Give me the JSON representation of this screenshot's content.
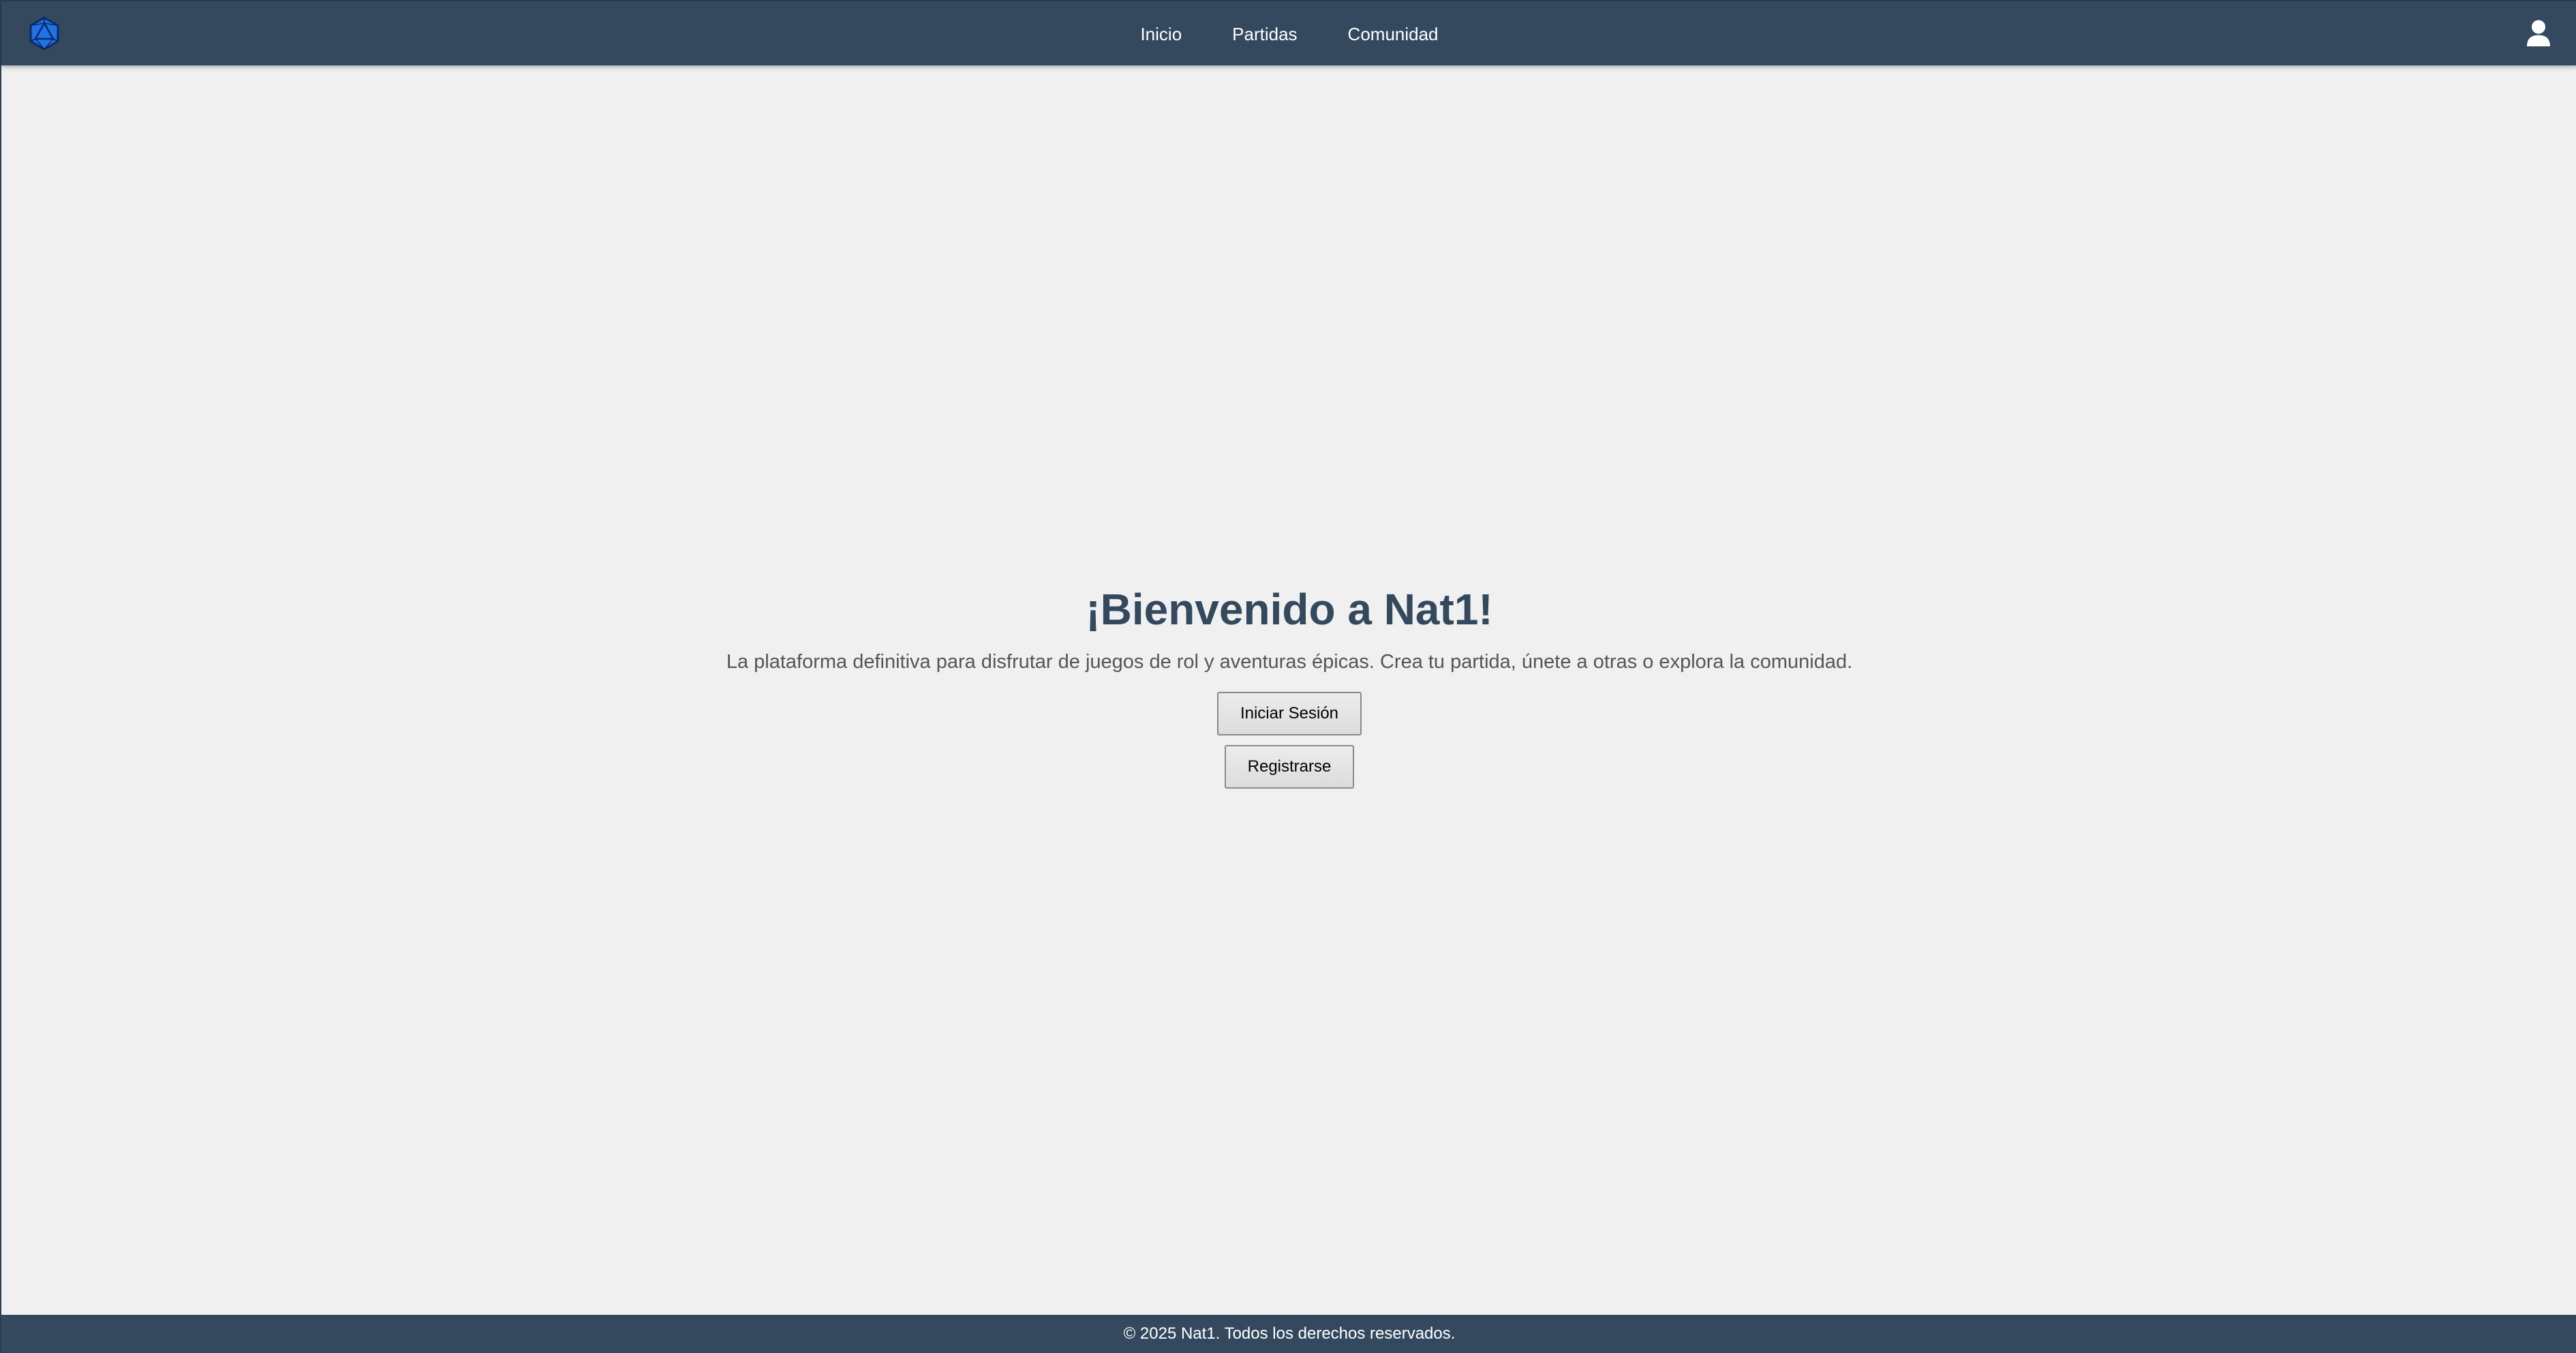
{
  "header": {
    "nav": [
      {
        "label": "Inicio"
      },
      {
        "label": "Partidas"
      },
      {
        "label": "Comunidad"
      }
    ]
  },
  "hero": {
    "title": "¡Bienvenido a Nat1!",
    "subtitle": "La plataforma definitiva para disfrutar de juegos de rol y aventuras épicas. Crea tu partida, únete a otras o explora la comunidad.",
    "login_label": "Iniciar Sesión",
    "register_label": "Registrarse"
  },
  "footer": {
    "text": "© 2025 Nat1. Todos los derechos reservados."
  },
  "icons": {
    "logo": "d20-dice-logo-icon",
    "user": "user-icon"
  },
  "colors": {
    "navbar": "#34495e",
    "title": "#34495e",
    "background": "#f0f0f0",
    "logo_blue": "#1e73e8"
  }
}
